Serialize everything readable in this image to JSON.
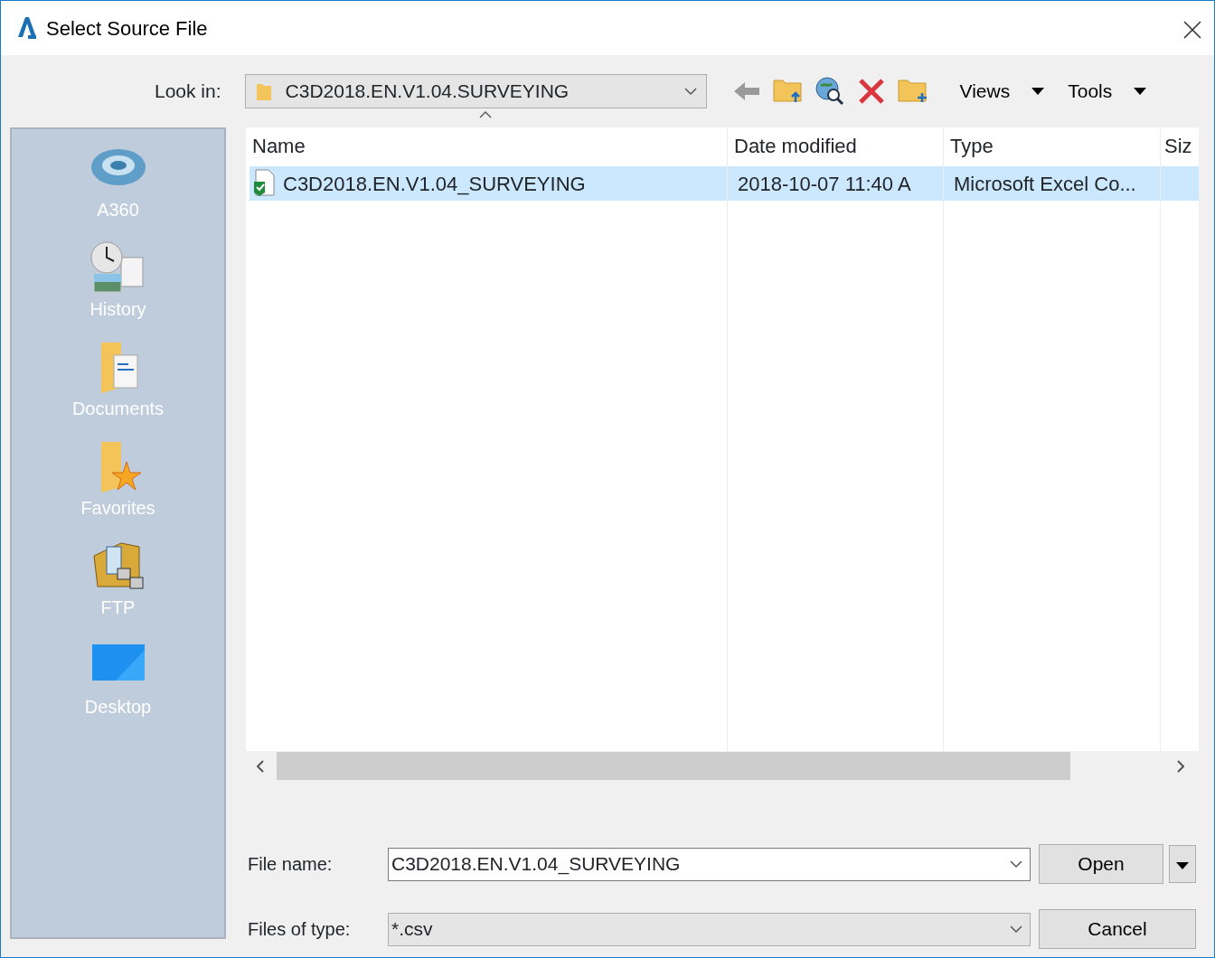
{
  "window": {
    "title": "Select Source File"
  },
  "look_in": {
    "label": "Look in:",
    "value": "C3D2018.EN.V1.04.SURVEYING"
  },
  "toolbar": {
    "views": "Views",
    "tools": "Tools"
  },
  "places": [
    {
      "kind": "a360",
      "label": "A360"
    },
    {
      "kind": "history",
      "label": "History"
    },
    {
      "kind": "documents",
      "label": "Documents"
    },
    {
      "kind": "favorites",
      "label": "Favorites"
    },
    {
      "kind": "ftp",
      "label": "FTP"
    },
    {
      "kind": "desktop",
      "label": "Desktop"
    }
  ],
  "table": {
    "columns": [
      "Name",
      "Date modified",
      "Type",
      "Siz"
    ],
    "rows": [
      {
        "selected": true,
        "cells": [
          "C3D2018.EN.V1.04_SURVEYING",
          "2018-10-07 11:40 A",
          "Microsoft Excel Co..."
        ]
      }
    ]
  },
  "file_name": {
    "label": "File name:",
    "value": "C3D2018.EN.V1.04_SURVEYING"
  },
  "file_type": {
    "label": "Files of type:",
    "value": "*.csv"
  },
  "buttons": {
    "open": "Open",
    "cancel": "Cancel"
  }
}
